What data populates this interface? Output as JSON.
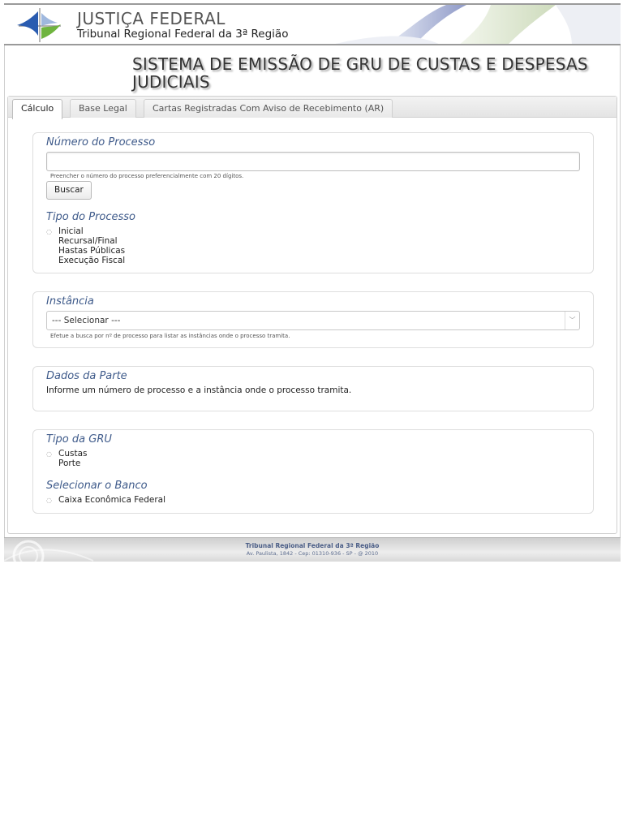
{
  "header": {
    "brand_title": "JUSTIÇA FEDERAL",
    "brand_subtitle": "Tribunal Regional Federal da 3ª Região"
  },
  "page": {
    "title": "SISTEMA DE EMISSÃO DE GRU DE CUSTAS E DESPESAS JUDICIAIS"
  },
  "tabs": [
    {
      "label": "Cálculo",
      "active": true
    },
    {
      "label": "Base Legal",
      "active": false
    },
    {
      "label": "Cartas Registradas Com Aviso de Recebimento (AR)",
      "active": false
    }
  ],
  "processo": {
    "title": "Número do Processo",
    "input_value": "",
    "hint": "Preencher o número do processo preferencialmente com 20 dígitos.",
    "search_button": "Buscar"
  },
  "tipo_processo": {
    "title": "Tipo do Processo",
    "options": [
      "Inicial",
      "Recursal/Final",
      "Hastas Públicas",
      "Execução Fiscal"
    ]
  },
  "instancia": {
    "title": "Instância",
    "selected": "--- Selecionar ---",
    "hint": "Efetue a busca por nº de processo para listar as instâncias onde o processo tramita."
  },
  "dados_parte": {
    "title": "Dados da Parte",
    "message": "Informe um número de processo e a instância onde o processo tramita."
  },
  "tipo_gru": {
    "title": "Tipo da GRU",
    "options": [
      "Custas",
      "Porte"
    ]
  },
  "banco": {
    "title": "Selecionar o Banco",
    "options": [
      "Caixa Econômica Federal"
    ]
  },
  "footer": {
    "line1": "Tribunal Regional Federal da 3ª Região",
    "line2": "Av. Paulista, 1842 - Cep: 01310-936 - SP - @ 2010"
  },
  "colors": {
    "section_title": "#3e5a8a",
    "logo_blue": "#2a5cb0",
    "logo_green": "#6fb43f"
  }
}
